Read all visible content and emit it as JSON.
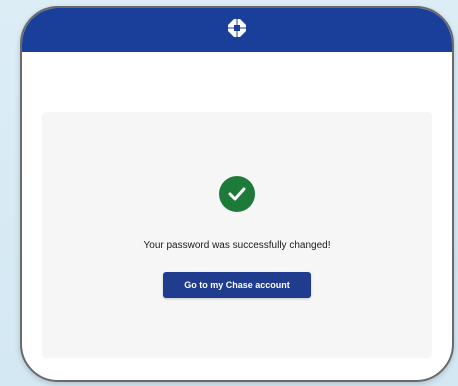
{
  "header": {
    "logo_icon": "chase-octagon-logo-icon",
    "background_color": "#1a3f9a"
  },
  "confirmation": {
    "status_icon": "check-circle-icon",
    "status_color": "#1d7a38",
    "message": "Your password was successfully changed!",
    "button_label": "Go to my Chase account",
    "button_color": "#1f3c8f"
  }
}
